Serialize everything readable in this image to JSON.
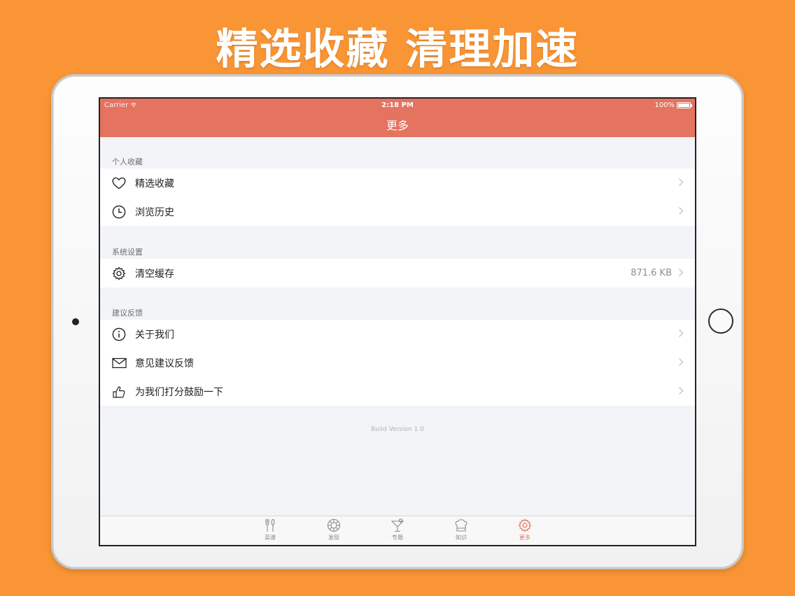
{
  "headline": "精选收藏 清理加速",
  "status_bar": {
    "carrier": "Carrier",
    "time": "2:18 PM",
    "battery": "100%"
  },
  "nav": {
    "title": "更多"
  },
  "sections": [
    {
      "header": "个人收藏",
      "items": [
        {
          "label": "精选收藏",
          "icon": "heart-icon"
        },
        {
          "label": "浏览历史",
          "icon": "clock-icon"
        }
      ]
    },
    {
      "header": "系统设置",
      "items": [
        {
          "label": "清空缓存",
          "icon": "gear-icon",
          "value": "871.6 KB"
        }
      ]
    },
    {
      "header": "建议反馈",
      "items": [
        {
          "label": "关于我们",
          "icon": "info-icon"
        },
        {
          "label": "意见建议反馈",
          "icon": "mail-icon"
        },
        {
          "label": "为我们打分鼓励一下",
          "icon": "thumbs-up-icon"
        }
      ]
    }
  ],
  "build_version": "Build Version 1.0",
  "tabs": [
    {
      "label": "菜谱",
      "icon": "utensils-icon",
      "active": false
    },
    {
      "label": "发现",
      "icon": "compass-icon",
      "active": false
    },
    {
      "label": "专题",
      "icon": "cocktail-icon",
      "active": false
    },
    {
      "label": "知识",
      "icon": "chef-hat-icon",
      "active": false
    },
    {
      "label": "更多",
      "icon": "gear-icon",
      "active": true
    }
  ],
  "colors": {
    "background": "#FA9535",
    "nav": "#E4735F",
    "accent": "#E4735F"
  }
}
